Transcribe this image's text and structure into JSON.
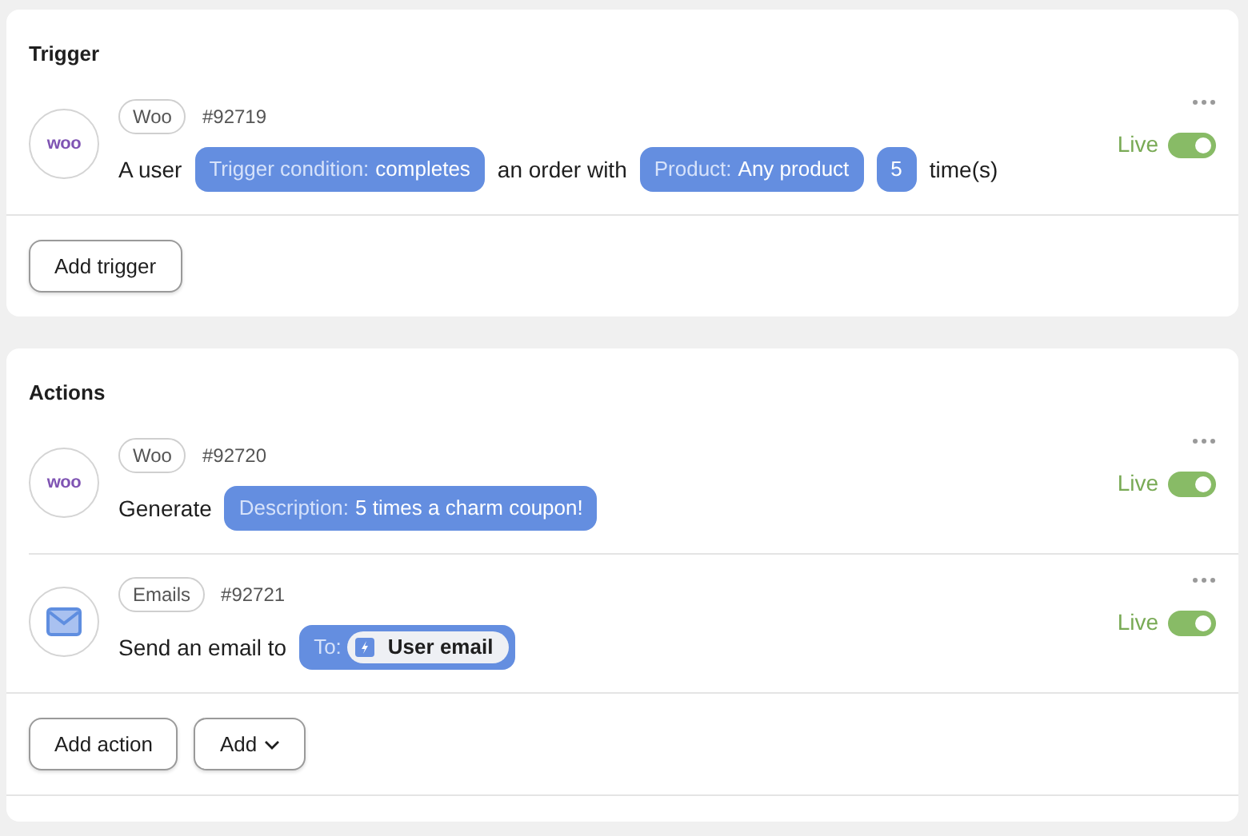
{
  "sections": [
    {
      "title": "Trigger",
      "steps": [
        {
          "logo": {
            "kind": "woo",
            "text": "woo"
          },
          "app": "Woo",
          "id": "#92719",
          "status": "Live",
          "on": true,
          "sentence": [
            {
              "kind": "text",
              "text": "A user"
            },
            {
              "kind": "pill",
              "label": "Trigger condition:",
              "value": "completes"
            },
            {
              "kind": "text",
              "text": "an order with"
            },
            {
              "kind": "pill",
              "label": "Product:",
              "value": "Any product"
            },
            {
              "kind": "pill",
              "value": "5"
            },
            {
              "kind": "text",
              "text": "time(s)"
            }
          ]
        }
      ],
      "buttons": [
        {
          "label": "Add trigger",
          "caret": false
        }
      ]
    },
    {
      "title": "Actions",
      "steps": [
        {
          "logo": {
            "kind": "woo",
            "text": "woo"
          },
          "app": "Woo",
          "id": "#92720",
          "status": "Live",
          "on": true,
          "sentence": [
            {
              "kind": "text",
              "text": "Generate"
            },
            {
              "kind": "pill",
              "label": "Description:",
              "value": "5 times a charm coupon!"
            }
          ]
        },
        {
          "logo": {
            "kind": "email"
          },
          "app": "Emails",
          "id": "#92721",
          "status": "Live",
          "on": true,
          "sentence": [
            {
              "kind": "text",
              "text": "Send an email to"
            },
            {
              "kind": "chip",
              "label": "To:",
              "value": "User email"
            }
          ]
        }
      ],
      "buttons": [
        {
          "label": "Add action",
          "caret": false
        },
        {
          "label": "Add",
          "caret": true
        }
      ]
    }
  ]
}
